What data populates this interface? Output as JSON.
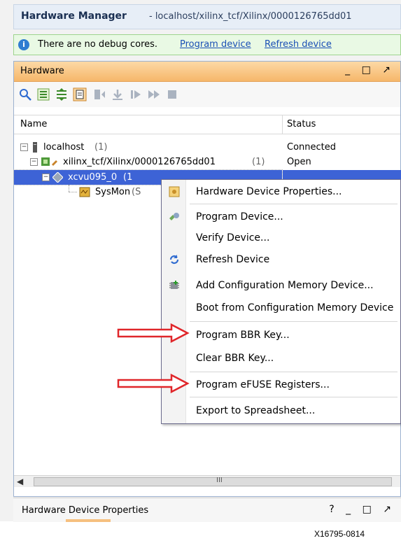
{
  "window": {
    "title": "Hardware Manager",
    "subtitle": "- localhost/xilinx_tcf/Xilinx/0000126765dd01"
  },
  "banner": {
    "message": "There are no debug cores.",
    "link_program": "Program device",
    "link_refresh": "Refresh device"
  },
  "hardware_panel": {
    "title": "Hardware",
    "window_buttons": "_ □ ↗",
    "columns": [
      "Name",
      "Status"
    ],
    "rows": [
      {
        "name": "localhost",
        "count": "(1)",
        "status": "Connected"
      },
      {
        "name": "xilinx_tcf/Xilinx/0000126765dd01",
        "count": "(1)",
        "status": "Open"
      },
      {
        "name": "xcvu095_0",
        "count": "(1",
        "status": ""
      },
      {
        "name": "SysMon",
        "count": "(S",
        "status": ""
      }
    ],
    "scrollbar_grip": "III"
  },
  "context_menu": {
    "items": [
      {
        "label": "Hardware Device Properties...",
        "icon": "properties-icon"
      },
      {
        "label": "Program Device...",
        "icon": "program-icon"
      },
      {
        "label": "Verify Device...",
        "icon": ""
      },
      {
        "label": "Refresh Device",
        "icon": "refresh-icon"
      },
      {
        "label": "Add Configuration Memory Device...",
        "icon": "add-memory-icon"
      },
      {
        "label": "Boot from Configuration Memory Device",
        "icon": ""
      },
      {
        "label": "Program BBR Key...",
        "icon": ""
      },
      {
        "label": "Clear BBR Key...",
        "icon": ""
      },
      {
        "label": "Program eFUSE Registers...",
        "icon": ""
      },
      {
        "label": "Export to Spreadsheet...",
        "icon": ""
      }
    ]
  },
  "bottom_panel": {
    "title": "Hardware Device Properties",
    "window_buttons": "? _ □ ↗"
  },
  "figure_id": "X16795-0814",
  "colors": {
    "accent_header": "#f6b76a",
    "selection": "#3d63d6",
    "banner_bg": "#e9f9e4",
    "annotation_arrow": "#e0262a"
  }
}
